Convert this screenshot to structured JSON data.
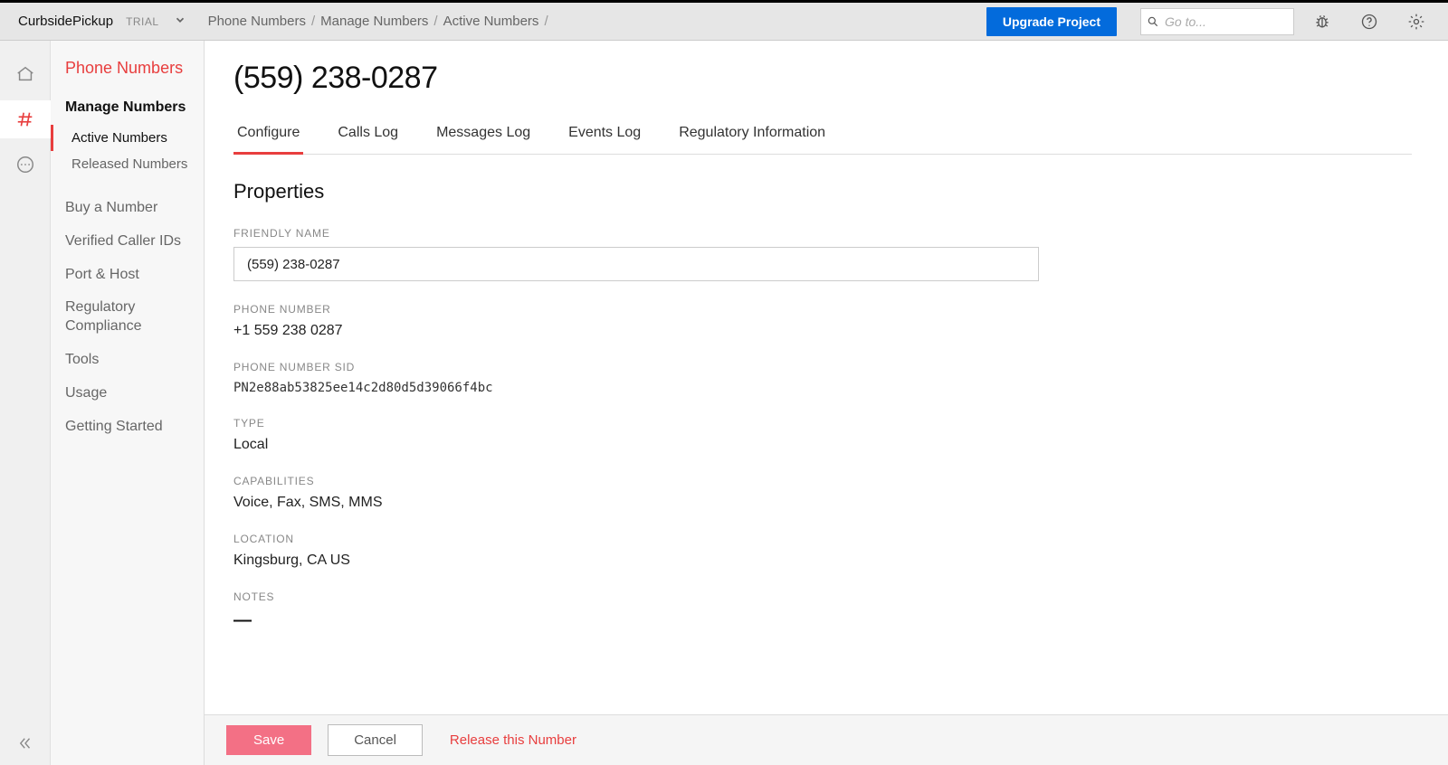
{
  "header": {
    "project_name": "CurbsidePickup",
    "trial_badge": "TRIAL",
    "breadcrumbs": [
      "Phone Numbers",
      "Manage Numbers",
      "Active Numbers"
    ],
    "upgrade_label": "Upgrade Project",
    "search_placeholder": "Go to..."
  },
  "sidebar": {
    "title": "Phone Numbers",
    "heading": "Manage Numbers",
    "sub": {
      "active": "Active Numbers",
      "released": "Released Numbers"
    },
    "links": {
      "buy": "Buy a Number",
      "verified": "Verified Caller IDs",
      "porthost": "Port & Host",
      "regulatory": "Regulatory Compliance",
      "tools": "Tools",
      "usage": "Usage",
      "getting_started": "Getting Started"
    }
  },
  "page": {
    "title": "(559) 238-0287",
    "tabs": {
      "configure": "Configure",
      "calls": "Calls Log",
      "messages": "Messages Log",
      "events": "Events Log",
      "regulatory": "Regulatory Information"
    },
    "section_title": "Properties",
    "props": {
      "friendly_name": {
        "label": "FRIENDLY NAME",
        "value": "(559) 238-0287"
      },
      "phone_number": {
        "label": "PHONE NUMBER",
        "value": "+1 559 238 0287"
      },
      "sid": {
        "label": "PHONE NUMBER SID",
        "value": "PN2e88ab53825ee14c2d80d5d39066f4bc"
      },
      "type": {
        "label": "TYPE",
        "value": "Local"
      },
      "capabilities": {
        "label": "CAPABILITIES",
        "value": "Voice, Fax, SMS, MMS"
      },
      "location": {
        "label": "LOCATION",
        "value": "Kingsburg, CA US"
      },
      "notes": {
        "label": "NOTES",
        "value": "—"
      }
    }
  },
  "footer": {
    "save": "Save",
    "cancel": "Cancel",
    "release": "Release this Number"
  }
}
